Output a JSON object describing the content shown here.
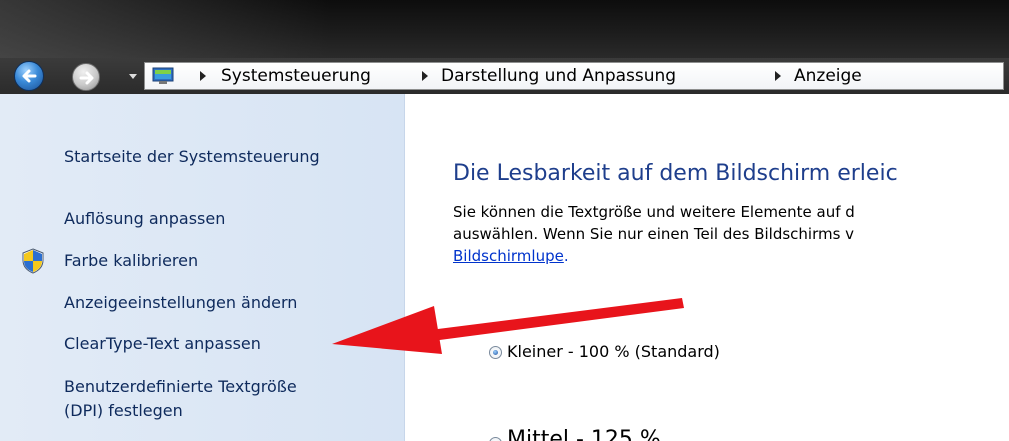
{
  "colors": {
    "sidebar_bg": "#dce7f5",
    "link": "#0e2a5c",
    "heading": "#1e3e8c",
    "annotation_arrow": "#e8141b"
  },
  "navigation": {
    "back_icon": "back-arrow-icon",
    "forward_icon": "forward-arrow-icon",
    "breadcrumb": [
      "Systemsteuerung",
      "Darstellung und Anpassung",
      "Anzeige"
    ]
  },
  "sidebar": {
    "items": [
      {
        "label": "Startseite der Systemsteuerung"
      },
      {
        "label": "Auflösung anpassen"
      },
      {
        "label": "Farbe kalibrieren",
        "icon": "uac-shield-icon"
      },
      {
        "label": "Anzeigeeinstellungen ändern"
      },
      {
        "label": "ClearType-Text anpassen"
      },
      {
        "label": "Benutzerdefinierte Textgröße"
      },
      {
        "label": "(DPI) festlegen"
      }
    ]
  },
  "main": {
    "heading": "Die Lesbarkeit auf dem Bildschirm erleic",
    "description_line1": "Sie können die Textgröße und weitere Elemente auf d",
    "description_line2": "auswählen. Wenn Sie nur einen Teil des Bildschirms v",
    "magnifier_link": "Bildschirmlupe",
    "magnifier_link_suffix": ".",
    "options": [
      {
        "label": "Kleiner - 100 % (Standard)",
        "selected": true
      },
      {
        "label": "Mittel - 125 %",
        "selected": false
      }
    ]
  }
}
